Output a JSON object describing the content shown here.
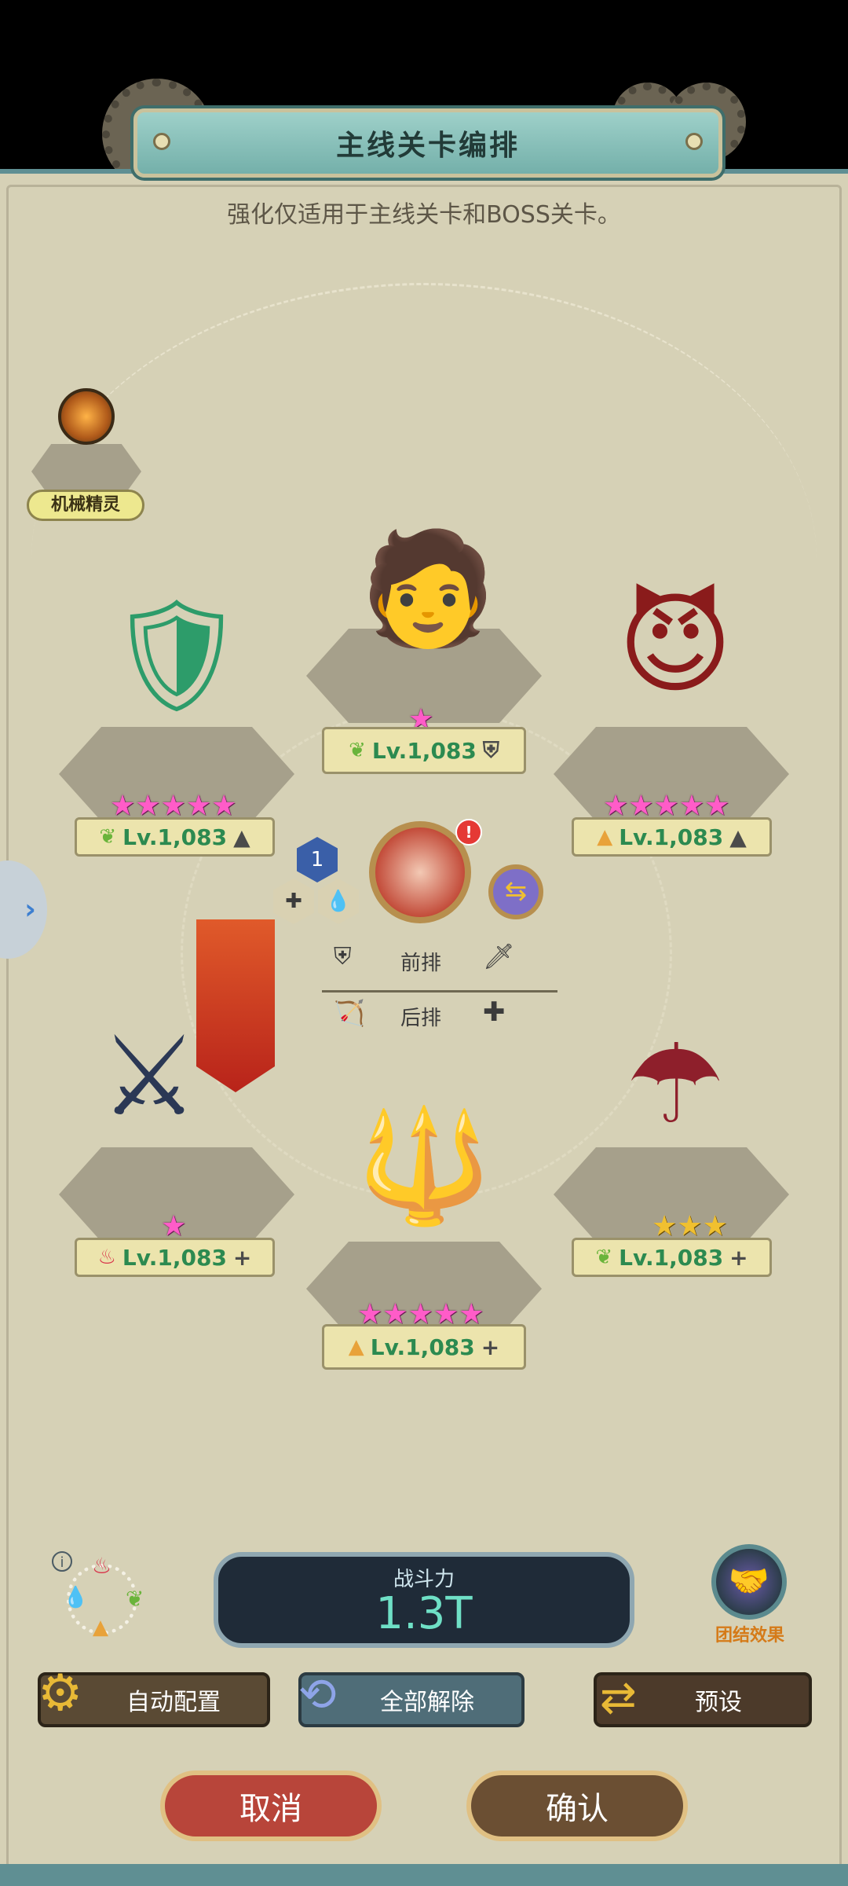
{
  "header": {
    "title": "主线关卡编排",
    "subtitle": "强化仅适用于主线关卡和BOSS关卡。"
  },
  "spirit": {
    "label": "机械精灵",
    "icon": "mech-bee-icon"
  },
  "slots": [
    {
      "id": "top-left",
      "stars": "★★★★★",
      "star_color": "pink",
      "element": "leaf",
      "element_glyph": "❦",
      "level": "Lv.1,083",
      "role_glyph": "▲",
      "char_glyph": "🛡"
    },
    {
      "id": "top-center",
      "stars": "★",
      "star_color": "pink",
      "element": "leaf",
      "element_glyph": "❦",
      "level": "Lv.1,083",
      "role_glyph": "⛨",
      "char_glyph": "🧑"
    },
    {
      "id": "top-right",
      "stars": "★★★★★",
      "star_color": "pink",
      "element": "earth",
      "element_glyph": "▲",
      "level": "Lv.1,083",
      "role_glyph": "▲",
      "char_glyph": "😈"
    },
    {
      "id": "bottom-left",
      "stars": "★",
      "star_color": "pink",
      "element": "fire",
      "element_glyph": "♨",
      "level": "Lv.1,083",
      "role_glyph": "+",
      "char_glyph": "⚔"
    },
    {
      "id": "bottom-center",
      "stars": "★★★★★",
      "star_color": "pink",
      "element": "earth",
      "element_glyph": "▲",
      "level": "Lv.1,083",
      "role_glyph": "+",
      "char_glyph": "🔱"
    },
    {
      "id": "bottom-right",
      "stars": "★★★",
      "star_color": "gold",
      "element": "leaf",
      "element_glyph": "❦",
      "level": "Lv.1,083",
      "role_glyph": "+",
      "char_glyph": "☂"
    }
  ],
  "center_panel": {
    "badge_number": "1",
    "notification": "!",
    "row_front_label": "前排",
    "row_back_label": "后排",
    "icons": [
      "shield-icon",
      "sword-icon",
      "bow-icon",
      "plus-icon",
      "swap-icon"
    ]
  },
  "power": {
    "label": "战斗力",
    "value": "1.3T"
  },
  "synergy": {
    "label": "团结效果"
  },
  "buttons": {
    "auto": "自动配置",
    "unequip_all": "全部解除",
    "preset": "预设",
    "cancel": "取消",
    "confirm": "确认"
  },
  "colors": {
    "frame": "#d6d1b6",
    "teal_banner": "#7fb9b2",
    "pink_star": "#ff5cc8",
    "level_green": "#2c8a50",
    "cancel_red": "#b8453a",
    "confirm_brown": "#6b4f33",
    "power_panel": "#1f2b38"
  }
}
